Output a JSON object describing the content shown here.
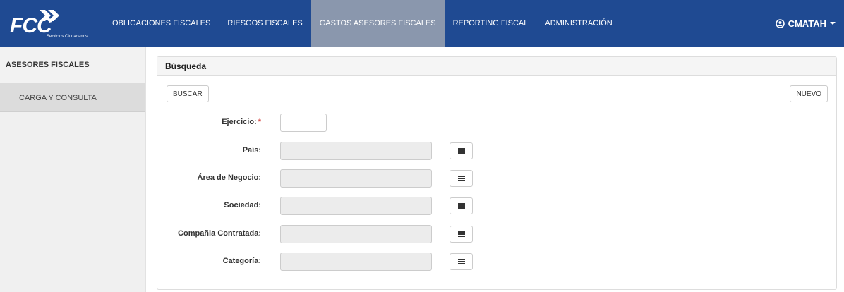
{
  "brand": {
    "logo_text": "FCC",
    "logo_subtext": "Servicios Ciudadanos"
  },
  "nav": {
    "items": [
      {
        "label": "OBLIGACIONES FISCALES",
        "active": false
      },
      {
        "label": "RIESGOS FISCALES",
        "active": false
      },
      {
        "label": "GASTOS ASESORES FISCALES",
        "active": true
      },
      {
        "label": "REPORTING FISCAL",
        "active": false
      },
      {
        "label": "ADMINISTRACIÓN",
        "active": false
      }
    ],
    "user": {
      "name": "CMATAH",
      "icon": "user-circle-icon"
    }
  },
  "sidebar": {
    "header": "ASESORES FISCALES",
    "items": [
      {
        "label": "CARGA Y CONSULTA"
      }
    ]
  },
  "panel": {
    "title": "Búsqueda",
    "search_button": "BUSCAR",
    "new_button": "NUEVO",
    "fields": [
      {
        "label": "Ejercicio:",
        "required": "*",
        "value": "",
        "type": "text"
      },
      {
        "label": "País:",
        "value": "",
        "type": "lookup"
      },
      {
        "label": "Área de Negocio:",
        "value": "",
        "type": "lookup"
      },
      {
        "label": "Sociedad:",
        "value": "",
        "type": "lookup"
      },
      {
        "label": "Compañia Contratada:",
        "value": "",
        "type": "lookup"
      },
      {
        "label": "Categoría:",
        "value": "",
        "type": "lookup"
      }
    ]
  },
  "colors": {
    "navbar": "#1f4a92",
    "nav_active": "#8a97ad",
    "required": "#d9534f"
  }
}
